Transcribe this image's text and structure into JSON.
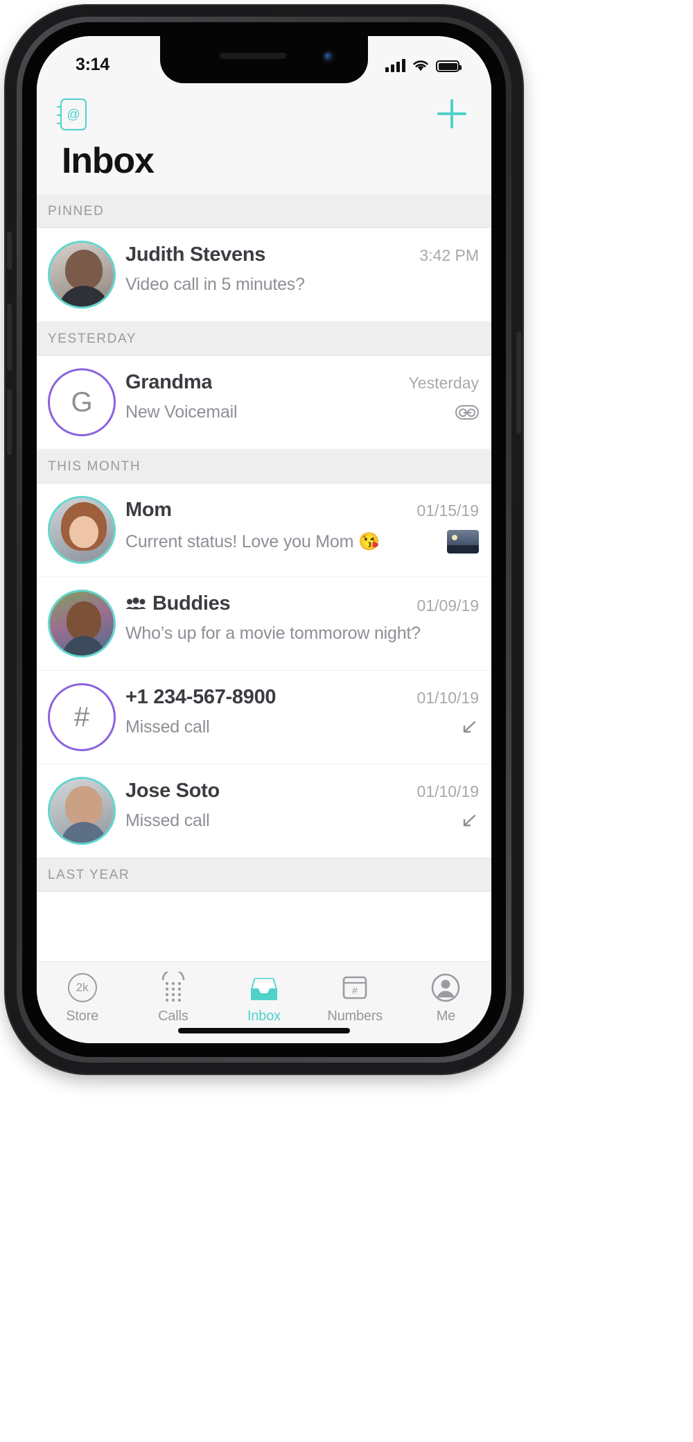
{
  "status_bar": {
    "time": "3:14",
    "signal_icon": "cellular-signal-icon",
    "wifi_icon": "wifi-icon",
    "battery_icon": "battery-full-icon"
  },
  "app_bar": {
    "contacts_icon": "contacts-book-icon",
    "contacts_glyph": "@",
    "compose_icon": "plus-icon"
  },
  "page_title": "Inbox",
  "sections": [
    {
      "header": "PINNED",
      "rows": [
        {
          "avatar": {
            "type": "photo",
            "ring": "teal",
            "photo_class": "ph-judith"
          },
          "name": "Judith Stevens",
          "time": "3:42 PM",
          "preview": "Video call in 5 minutes?",
          "meta_icon": ""
        }
      ]
    },
    {
      "header": "YESTERDAY",
      "rows": [
        {
          "avatar": {
            "type": "initial",
            "ring": "purple",
            "initial": "G"
          },
          "name": "Grandma",
          "time": "Yesterday",
          "preview": "New Voicemail",
          "meta_icon": "voicemail-icon"
        }
      ]
    },
    {
      "header": "THIS MONTH",
      "rows": [
        {
          "avatar": {
            "type": "photo",
            "ring": "teal",
            "photo_class": "ph-mom"
          },
          "name": "Mom",
          "time": "01/15/19",
          "preview": "Current status! Love you Mom 😘",
          "meta_icon": "photo-attachment-icon"
        },
        {
          "avatar": {
            "type": "photo",
            "ring": "teal",
            "photo_class": "ph-bud"
          },
          "name": "Buddies",
          "group": true,
          "group_icon": "group-people-icon",
          "time": "01/09/19",
          "preview": "Who’s up for a movie tommorow night?",
          "meta_icon": ""
        },
        {
          "avatar": {
            "type": "initial",
            "ring": "purple",
            "initial": "#"
          },
          "name": "+1 234-567-8900",
          "time": "01/10/19",
          "preview": "Missed call",
          "meta_icon": "missed-call-icon"
        },
        {
          "avatar": {
            "type": "photo",
            "ring": "teal",
            "photo_class": "ph-jose"
          },
          "name": "Jose Soto",
          "time": "01/10/19",
          "preview": "Missed call",
          "meta_icon": "missed-call-icon"
        }
      ]
    },
    {
      "header": "LAST YEAR",
      "rows": []
    }
  ],
  "tab_bar": {
    "tabs": [
      {
        "label": "Store",
        "icon": "store-credits-icon",
        "badge": "2k",
        "active": false
      },
      {
        "label": "Calls",
        "icon": "keypad-icon",
        "active": false
      },
      {
        "label": "Inbox",
        "icon": "inbox-tray-icon",
        "active": true
      },
      {
        "label": "Numbers",
        "icon": "numbers-card-icon",
        "active": false
      },
      {
        "label": "Me",
        "icon": "profile-avatar-icon",
        "active": false
      }
    ]
  },
  "colors": {
    "accent": "#4fd2c9",
    "purple_ring": "#8b62e0",
    "section_bg": "#eeeeef",
    "muted_text": "#8e8e96"
  }
}
